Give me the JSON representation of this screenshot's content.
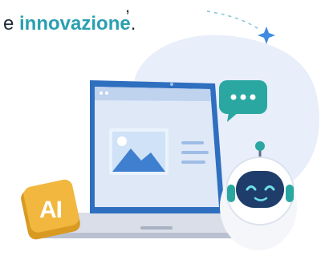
{
  "headline": {
    "prefix": "e ",
    "highlight": "innovazione",
    "suffix": ".",
    "top_fragment": ","
  },
  "badge": {
    "label": "AI"
  },
  "colors": {
    "highlight": "#2a9fb0",
    "blob": "#e8eefa",
    "laptop_body": "#4a90e2",
    "laptop_dark": "#2f6fbf",
    "bubble": "#2aa7a1",
    "badge": "#f2b73f",
    "robot_face": "#1f3d6b"
  },
  "icons": [
    "sparkle-icon",
    "chat-bubble-icon",
    "image-placeholder-icon",
    "ai-badge-icon",
    "robot-mascot-icon"
  ]
}
